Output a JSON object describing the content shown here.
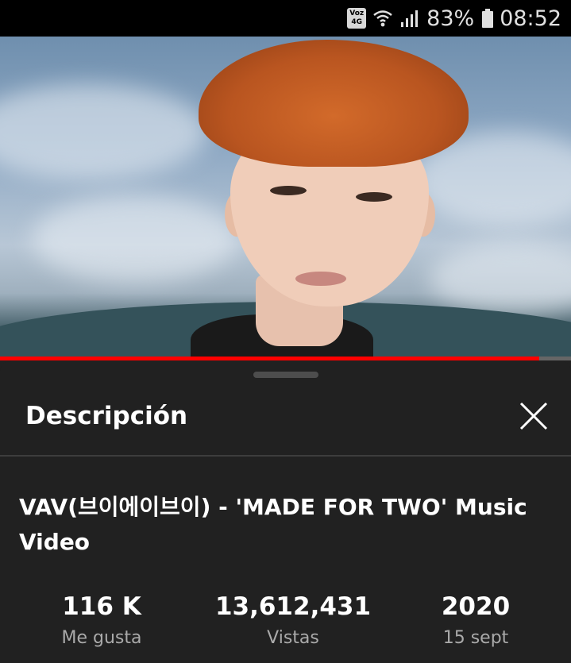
{
  "status_bar": {
    "network_badge_top": "Voz",
    "network_badge_bottom": "4G",
    "battery_percent": "83%",
    "time": "08:52",
    "icons": [
      "wifi-icon",
      "signal-icon",
      "battery-icon"
    ]
  },
  "player": {
    "progress_fraction": 0.945,
    "progress_color": "#ff0000"
  },
  "description_panel": {
    "title": "Descripción",
    "video_title": "VAV(브이에이브이) - 'MADE FOR TWO' Music Video",
    "stats": [
      {
        "value": "116 K",
        "label": "Me gusta"
      },
      {
        "value": "13,612,431",
        "label": "Vistas"
      },
      {
        "value": "2020",
        "label": "15 sept"
      }
    ]
  }
}
